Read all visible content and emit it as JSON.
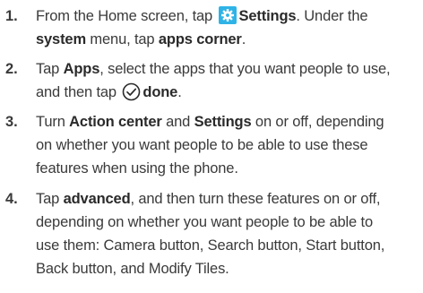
{
  "steps": [
    {
      "number": "1.",
      "lines": [
        {
          "t1": "From the Home screen, tap ",
          "b1": "Settings",
          "t2": ". Under the"
        },
        {
          "b1": "system",
          "t1": " menu, tap ",
          "b2": "apps corner",
          "t2": "."
        }
      ],
      "icon": "settings-gear-icon"
    },
    {
      "number": "2.",
      "lines": [
        {
          "t1": "Tap ",
          "b1": "Apps",
          "t2": ", select the apps that you want people to use,"
        },
        {
          "t1": "and then tap ",
          "b1": "done",
          "t2": "."
        }
      ],
      "icon": "check-circle-icon"
    },
    {
      "number": "3.",
      "lines": [
        {
          "t1": "Turn ",
          "b1": "Action center",
          "t2": " and ",
          "b2": "Settings",
          "t3": " on or off, depending"
        },
        {
          "t1": "on whether you want people to be able to use these"
        },
        {
          "t1": "features when using the phone."
        }
      ]
    },
    {
      "number": "4.",
      "lines": [
        {
          "t1": "Tap ",
          "b1": "advanced",
          "t2": ", and then turn these features on or off,"
        },
        {
          "t1": "depending on whether you want people to be able to"
        },
        {
          "t1": "use them: Camera button, Search button, Start button,"
        },
        {
          "t1": "Back button, and Modify Tiles."
        }
      ]
    }
  ],
  "colors": {
    "text": "#3a3a3a",
    "accent_icon": "#2fb3e6"
  }
}
